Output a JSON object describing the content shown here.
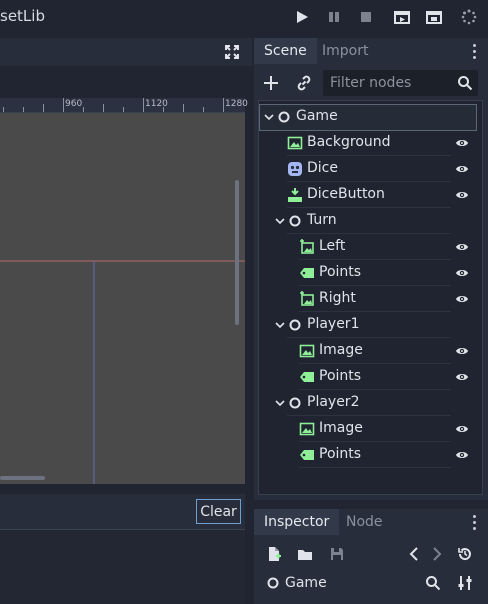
{
  "topbar": {
    "title": "setLib"
  },
  "ruler": {
    "labels": [
      "960",
      "1120",
      "1280"
    ]
  },
  "output": {
    "clear_label": "Clear"
  },
  "scene_panel": {
    "tabs": [
      "Scene",
      "Import"
    ],
    "filter_placeholder": "Filter nodes",
    "nodes": [
      {
        "label": "Game",
        "icon": "node-circle-icon",
        "depth": 0,
        "collapsible": true,
        "eye": false,
        "selected": true
      },
      {
        "label": "Background",
        "icon": "texture-rect-icon",
        "depth": 1,
        "collapsible": false,
        "eye": true
      },
      {
        "label": "Dice",
        "icon": "dice-script-icon",
        "depth": 1,
        "collapsible": false,
        "eye": true
      },
      {
        "label": "DiceButton",
        "icon": "texture-button-icon",
        "depth": 1,
        "collapsible": false,
        "eye": true
      },
      {
        "label": "Turn",
        "icon": "node-circle-icon",
        "depth": 1,
        "collapsible": true,
        "eye": false
      },
      {
        "label": "Left",
        "icon": "animated-sprite-icon",
        "depth": 2,
        "collapsible": false,
        "eye": true
      },
      {
        "label": "Points",
        "icon": "label-icon",
        "depth": 2,
        "collapsible": false,
        "eye": true
      },
      {
        "label": "Right",
        "icon": "animated-sprite-icon",
        "depth": 2,
        "collapsible": false,
        "eye": true
      },
      {
        "label": "Player1",
        "icon": "node-circle-icon",
        "depth": 1,
        "collapsible": true,
        "eye": false
      },
      {
        "label": "Image",
        "icon": "texture-rect-icon",
        "depth": 2,
        "collapsible": false,
        "eye": true
      },
      {
        "label": "Points",
        "icon": "label-icon",
        "depth": 2,
        "collapsible": false,
        "eye": true
      },
      {
        "label": "Player2",
        "icon": "node-circle-icon",
        "depth": 1,
        "collapsible": true,
        "eye": false
      },
      {
        "label": "Image",
        "icon": "texture-rect-icon",
        "depth": 2,
        "collapsible": false,
        "eye": true
      },
      {
        "label": "Points",
        "icon": "label-icon",
        "depth": 2,
        "collapsible": false,
        "eye": true
      }
    ]
  },
  "inspector_panel": {
    "tabs": [
      "Inspector",
      "Node"
    ],
    "object_name": "Game"
  },
  "colors": {
    "accent": "#6d9fd3",
    "node_green": "#8eef97",
    "panel_bg": "#272d3a",
    "tree_bg": "#1f2430",
    "canvas": "#4a4a4a"
  }
}
